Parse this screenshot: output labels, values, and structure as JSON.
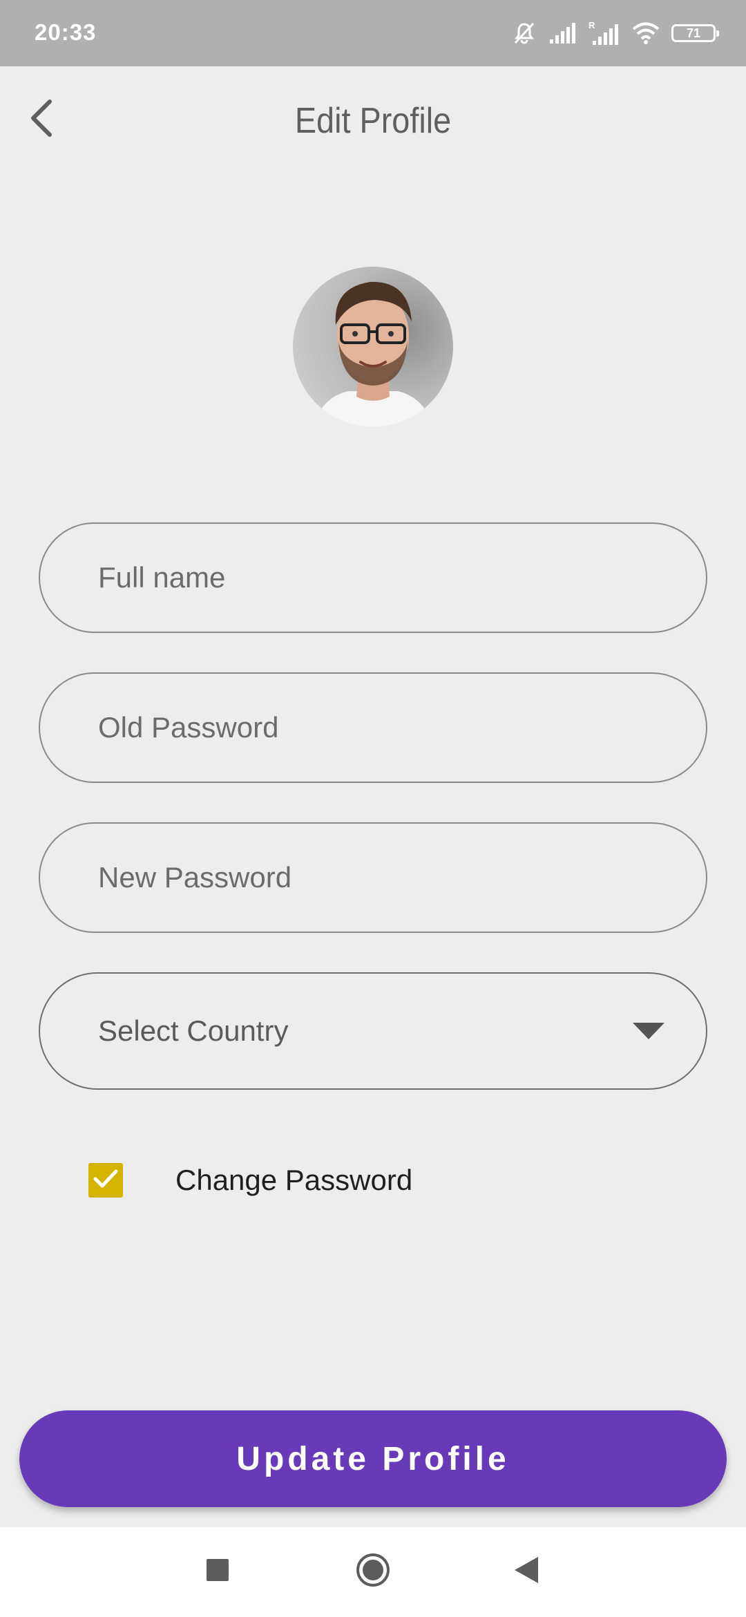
{
  "status_bar": {
    "time": "20:33",
    "battery_level": "71",
    "icons": [
      "mute-icon",
      "signal-icon",
      "signal-roaming-icon",
      "wifi-icon",
      "battery-icon"
    ]
  },
  "header": {
    "title": "Edit Profile",
    "back_icon": "chevron-left-icon"
  },
  "form": {
    "full_name": {
      "placeholder": "Full name",
      "value": ""
    },
    "old_password": {
      "placeholder": "Old Password",
      "value": ""
    },
    "new_password": {
      "placeholder": "New Password",
      "value": ""
    },
    "country_select": {
      "selected": "Select Country",
      "icon": "caret-down-icon"
    },
    "change_password": {
      "label": "Change Password",
      "checked": true
    }
  },
  "actions": {
    "update_label": "Update Profile"
  },
  "colors": {
    "status_bar": "#b0b0b0",
    "background": "#ededed",
    "accent": "#673ab7",
    "checkbox": "#d4b400"
  },
  "nav_bar": {
    "icons": [
      "recents-icon",
      "home-icon",
      "back-icon"
    ]
  }
}
